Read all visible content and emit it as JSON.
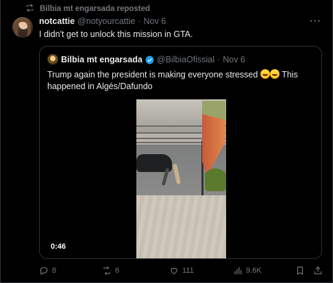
{
  "repost": {
    "label": "Bilbia mt engarsada reposted"
  },
  "tweet": {
    "author_name": "notcattie",
    "author_handle": "@notyourcattie",
    "separator": "·",
    "date": "Nov 6",
    "more": "···",
    "text": "I didn't get to unlock this mission in GTA."
  },
  "quote": {
    "author_name": "Bilbia mt engarsada",
    "author_handle": "@BilbiaOfissial",
    "separator": "·",
    "date": "Nov 6",
    "text_line1": "Trump again the president is making everyone stressed",
    "text_after_emoji": "This",
    "text_line2": "happened in Algés/Dafundo",
    "emoji_name": "rofl-emoji",
    "video_duration": "0:46"
  },
  "actions": {
    "replies": "8",
    "reposts": "6",
    "likes": "111",
    "views": "9.6K"
  },
  "colors": {
    "background": "#000000",
    "text": "#e7e9ea",
    "muted": "#71767b",
    "border": "#2f3336",
    "verified": "#1d9bf0"
  }
}
